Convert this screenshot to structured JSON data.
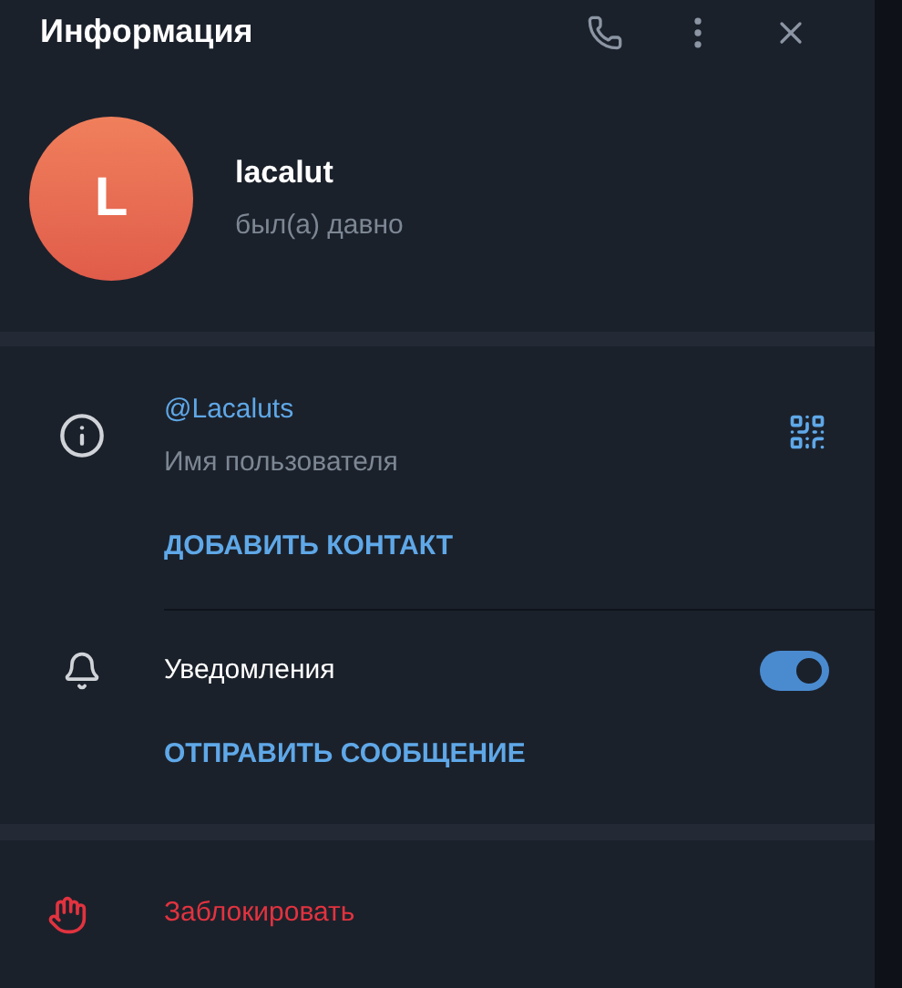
{
  "header": {
    "title": "Информация"
  },
  "profile": {
    "initial": "L",
    "name": "lacalut",
    "status": "был(а) давно"
  },
  "username": {
    "value": "@Lacaluts",
    "label": "Имя пользователя"
  },
  "actions": [
    {
      "label": "ДОБАВИТЬ КОНТАКТ"
    }
  ],
  "notifications": {
    "label": "Уведомления",
    "on": true
  },
  "send": {
    "label": "ОТПРАВИТЬ СООБЩЕНИЕ"
  },
  "block": {
    "label": "Заблокировать"
  }
}
